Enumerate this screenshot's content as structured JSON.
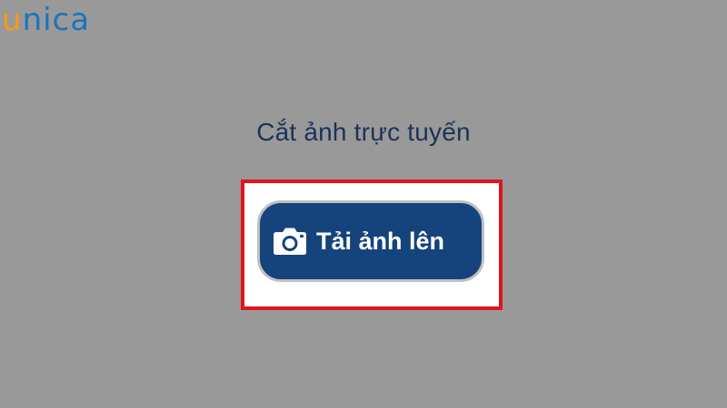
{
  "logo": {
    "first_letter": "u",
    "rest": "nica",
    "colors": {
      "first_letter": "#f39a21",
      "rest": "#1a75bb"
    }
  },
  "page": {
    "title": "Cắt ảnh trực tuyến",
    "background": "#999999"
  },
  "upload": {
    "icon": "camera-icon",
    "label": "Tải ảnh lên",
    "button_color": "#15437c",
    "highlight_color": "#e0141e"
  }
}
